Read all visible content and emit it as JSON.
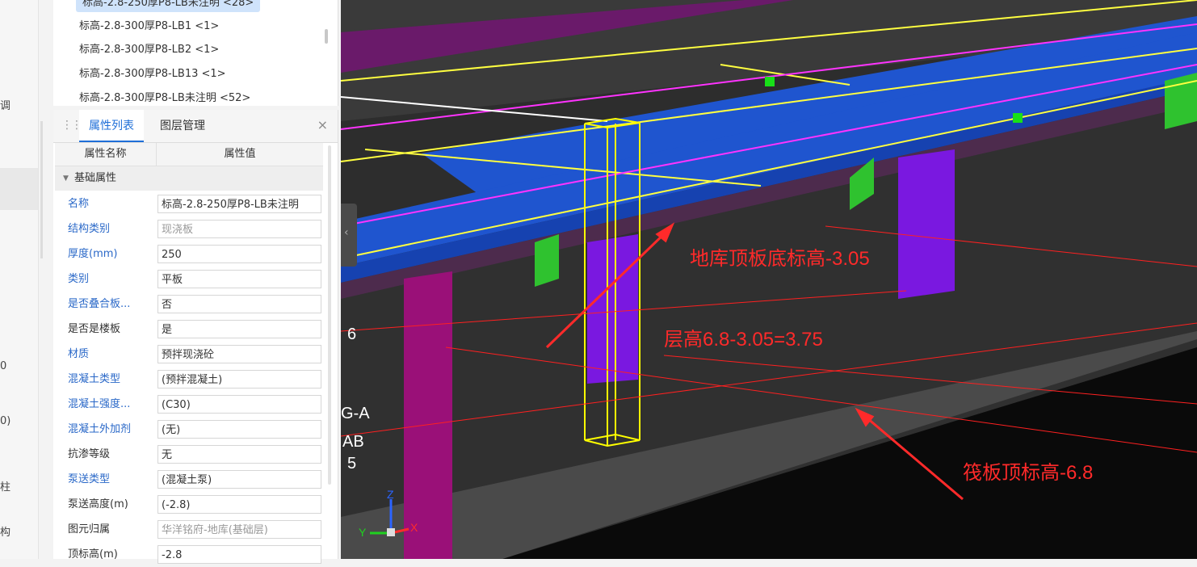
{
  "left_strip": {
    "fragments": [
      "调",
      "0",
      "0)",
      "柱",
      "构"
    ]
  },
  "component_list": {
    "items": [
      {
        "label": "标高-2.8-250厚P8-LB未注明 <28>",
        "selected": true
      },
      {
        "label": "标高-2.8-300厚P8-LB1 <1>",
        "selected": false
      },
      {
        "label": "标高-2.8-300厚P8-LB2 <1>",
        "selected": false
      },
      {
        "label": "标高-2.8-300厚P8-LB13 <1>",
        "selected": false
      },
      {
        "label": "标高-2.8-300厚P8-LB未注明 <52>",
        "selected": false
      }
    ]
  },
  "properties_panel": {
    "tabs": [
      {
        "label": "属性列表",
        "active": true
      },
      {
        "label": "图层管理",
        "active": false
      }
    ],
    "close_symbol": "×",
    "columns": {
      "name": "属性名称",
      "value": "属性值"
    },
    "group": "基础属性",
    "rows": [
      {
        "name": "名称",
        "value": "标高-2.8-250厚P8-LB未注明",
        "name_blue": true,
        "value_grey": false
      },
      {
        "name": "结构类别",
        "value": "现浇板",
        "name_blue": true,
        "value_grey": true
      },
      {
        "name": "厚度(mm)",
        "value": "250",
        "name_blue": true,
        "value_grey": false
      },
      {
        "name": "类别",
        "value": "平板",
        "name_blue": true,
        "value_grey": false
      },
      {
        "name": "是否叠合板...",
        "value": "否",
        "name_blue": true,
        "value_grey": false
      },
      {
        "name": "是否是楼板",
        "value": "是",
        "name_blue": false,
        "value_grey": false
      },
      {
        "name": "材质",
        "value": "预拌现浇砼",
        "name_blue": true,
        "value_grey": false
      },
      {
        "name": "混凝土类型",
        "value": "(预拌混凝土)",
        "name_blue": true,
        "value_grey": false
      },
      {
        "name": "混凝土强度...",
        "value": "(C30)",
        "name_blue": true,
        "value_grey": false
      },
      {
        "name": "混凝土外加剂",
        "value": "(无)",
        "name_blue": true,
        "value_grey": false
      },
      {
        "name": "抗渗等级",
        "value": "无",
        "name_blue": false,
        "value_grey": false
      },
      {
        "name": "泵送类型",
        "value": "(混凝土泵)",
        "name_blue": true,
        "value_grey": false
      },
      {
        "name": "泵送高度(m)",
        "value": "(-2.8)",
        "name_blue": false,
        "value_grey": false
      },
      {
        "name": "图元归属",
        "value": "华洋铭府-地库(基础层)",
        "name_blue": false,
        "value_grey": true
      },
      {
        "name": "顶标高(m)",
        "value": "-2.8",
        "name_blue": false,
        "value_grey": false
      }
    ]
  },
  "viewport": {
    "annotations": [
      {
        "text": "地库顶板底标高-3.05"
      },
      {
        "text": "层高6.8-3.05=3.75"
      },
      {
        "text": "筏板顶标高-6.8"
      }
    ],
    "grid_labels": [
      "6",
      "G-A",
      "AB",
      "5"
    ],
    "axis": {
      "z": "Z",
      "y": "Y",
      "x": "X"
    },
    "collapse_symbol": "‹",
    "colors": {
      "annotation": "#ff2a2a",
      "beam_blue": "#1f57d6",
      "beam_green": "#2fc22f",
      "column_purple": "#7a18e0",
      "column_magenta": "#9a1078",
      "rebar_yellow": "#ffff40",
      "rebar_magenta": "#ff33ff"
    }
  }
}
